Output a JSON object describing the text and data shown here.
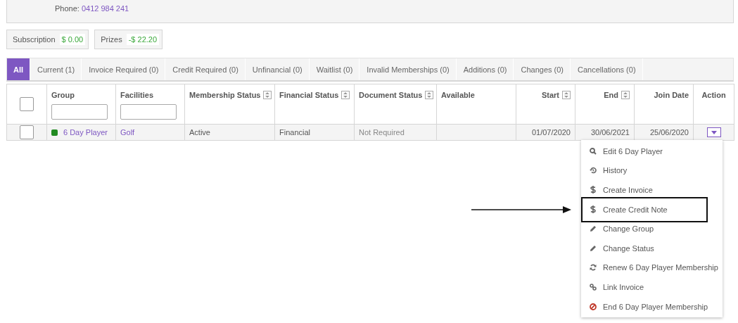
{
  "contact": {
    "phone_label": "Phone:",
    "phone": "0412 984 241"
  },
  "summaries": [
    {
      "label": "Subscription",
      "value": "$ 0.00"
    },
    {
      "label": "Prizes",
      "value": "-$ 22.20"
    }
  ],
  "tabs": [
    {
      "label": "All",
      "selected": true
    },
    {
      "label": "Current (1)",
      "selected": false
    },
    {
      "label": "Invoice Required (0)",
      "selected": false
    },
    {
      "label": "Credit Required (0)",
      "selected": false
    },
    {
      "label": "Unfinancial (0)",
      "selected": false
    },
    {
      "label": "Waitlist (0)",
      "selected": false
    },
    {
      "label": "Invalid Memberships (0)",
      "selected": false
    },
    {
      "label": "Additions (0)",
      "selected": false
    },
    {
      "label": "Changes (0)",
      "selected": false
    },
    {
      "label": "Cancellations (0)",
      "selected": false
    }
  ],
  "table": {
    "select_all": {
      "checked": false
    },
    "columns": [
      {
        "label": "Group",
        "kind": "text",
        "sortable": false,
        "filter": true
      },
      {
        "label": "Facilities",
        "kind": "text",
        "sortable": false,
        "filter": true
      },
      {
        "label": "Membership Status",
        "kind": "text",
        "sortable": true,
        "filter": false
      },
      {
        "label": "Financial Status",
        "kind": "text",
        "sortable": true,
        "filter": false
      },
      {
        "label": "Document Status",
        "kind": "text",
        "sortable": true,
        "filter": false
      },
      {
        "label": "Available",
        "kind": "text",
        "sortable": false,
        "filter": false
      },
      {
        "label": "Start",
        "kind": "date",
        "sortable": true,
        "filter": false
      },
      {
        "label": "End",
        "kind": "date",
        "sortable": true,
        "filter": false
      },
      {
        "label": "Join Date",
        "kind": "date",
        "sortable": false,
        "filter": false
      },
      {
        "label": "Action",
        "kind": "action",
        "sortable": false,
        "filter": false
      }
    ],
    "rows": [
      {
        "checked": false,
        "color": "#228b22",
        "group": "6 Day Player",
        "facilities": "Golf",
        "membership_status": "Active",
        "financial_status": "Financial",
        "document_status": "Not Required",
        "start": "01/07/2020",
        "end": "30/06/2021",
        "join_date": "25/06/2020"
      }
    ]
  },
  "action_menu": {
    "items": [
      {
        "kind": "view",
        "label": "Edit 6 Day Player",
        "highlighted": false
      },
      {
        "kind": "history",
        "label": "History",
        "highlighted": false
      },
      {
        "kind": "money",
        "label": "Create Invoice",
        "highlighted": false
      },
      {
        "kind": "money",
        "label": "Create Credit Note",
        "highlighted": true
      },
      {
        "kind": "edit",
        "label": "Change Group",
        "highlighted": false
      },
      {
        "kind": "edit",
        "label": "Change Status",
        "highlighted": false
      },
      {
        "kind": "renew",
        "label": "Renew 6 Day Player Membership",
        "highlighted": false
      },
      {
        "kind": "link",
        "label": "Link Invoice",
        "highlighted": false
      },
      {
        "kind": "end",
        "label": "End 6 Day Player Membership",
        "highlighted": false
      }
    ]
  }
}
